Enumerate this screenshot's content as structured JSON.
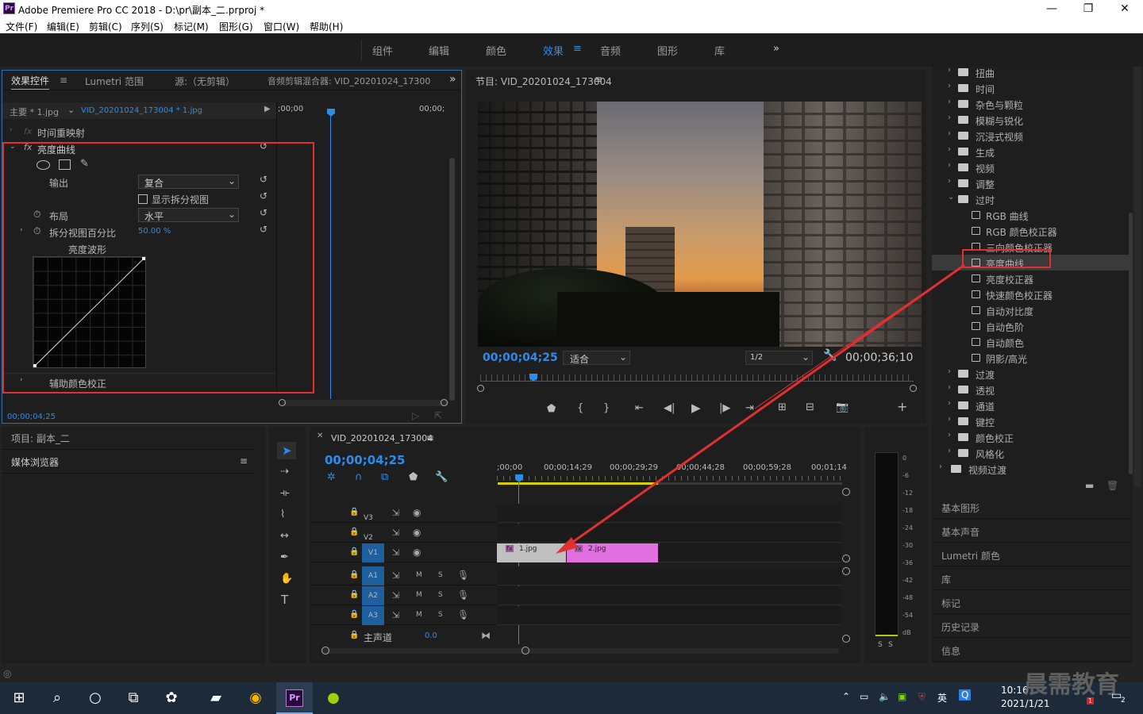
{
  "window": {
    "title": "Adobe Premiere Pro CC 2018 - D:\\pr\\副本_二.prproj *",
    "logo": "Pr",
    "controls": [
      "—",
      "❐",
      "✕"
    ]
  },
  "menu": [
    "文件(F)",
    "编辑(E)",
    "剪辑(C)",
    "序列(S)",
    "标记(M)",
    "图形(G)",
    "窗口(W)",
    "帮助(H)"
  ],
  "workspaces": [
    "组件",
    "编辑",
    "颜色",
    "效果",
    "音频",
    "图形",
    "库"
  ],
  "workspace_active": "效果",
  "effect_controls": {
    "tabs": [
      "效果控件",
      "Lumetri 范围",
      "源:（无剪辑）",
      "音频剪辑混合器: VID_20201024_17300"
    ],
    "master": "主要 * 1.jpg",
    "clip": "VID_20201024_173004 * 1.jpg",
    "tc_start": ";00;00",
    "tc_end": "00;00;",
    "time_remap": "时间重映射",
    "effect_name": "亮度曲线",
    "output_label": "输出",
    "output_value": "复合",
    "split_label": "显示拆分视图",
    "layout_label": "布局",
    "layout_value": "水平",
    "split_pct_label": "拆分视图百分比",
    "split_pct_value": "50.00 %",
    "waveform_label": "亮度波形",
    "secondary": "辅助颜色校正",
    "timecode": "00;00;04;25"
  },
  "program": {
    "title": "节目: VID_20201024_173004",
    "timecode": "00;00;04;25",
    "fit": "适合",
    "resolution": "1/2",
    "duration": "00;00;36;10"
  },
  "effects_tree": {
    "folders_top": [
      "扭曲",
      "时间",
      "杂色与颗粒",
      "模糊与锐化",
      "沉浸式视频",
      "生成",
      "视频",
      "调整",
      "过时"
    ],
    "presets": [
      "RGB 曲线",
      "RGB 颜色校正器",
      "三向颜色校正器",
      "亮度曲线",
      "亮度校正器",
      "快速颜色校正器",
      "自动对比度",
      "自动色阶",
      "自动颜色",
      "阴影/高光"
    ],
    "selected": "亮度曲线",
    "folders_bottom": [
      "过渡",
      "透视",
      "通道",
      "键控",
      "颜色校正",
      "风格化"
    ],
    "root_last": "视频过渡"
  },
  "right_panels": [
    "基本图形",
    "基本声音",
    "Lumetri 颜色",
    "库",
    "标记",
    "历史记录",
    "信息"
  ],
  "project": {
    "title": "项目: 副本_二",
    "media_browser": "媒体浏览器"
  },
  "timeline": {
    "title": "VID_20201024_173004",
    "timecode": "00;00;04;25",
    "ruler": [
      ";00;00",
      "00;00;14;29",
      "00;00;29;29",
      "00;00;44;28",
      "00;00;59;28",
      "00;01;14"
    ],
    "tracks_video": [
      "V3",
      "V2",
      "V1"
    ],
    "tracks_audio": [
      "A1",
      "A2",
      "A3"
    ],
    "master": "主声道",
    "master_val": "0.0",
    "clips": [
      {
        "name": "1.jpg"
      },
      {
        "name": "2.jpg"
      }
    ]
  },
  "meter": {
    "scale": [
      "0",
      "-6",
      "-12",
      "-18",
      "-24",
      "-30",
      "-36",
      "-42",
      "-48",
      "-54",
      "dB"
    ],
    "solo": [
      "S",
      "S"
    ]
  },
  "taskbar": {
    "time": "10:16",
    "date": "2021/1/21",
    "ime": "英",
    "watermark": "晨需教育",
    "notify_count": "2",
    "badge": "1"
  },
  "colors": {
    "accent": "#2d8ceb",
    "highlight_box": "#e03030",
    "clip2": "#e070e0",
    "clip1": "#c0c0c0"
  }
}
